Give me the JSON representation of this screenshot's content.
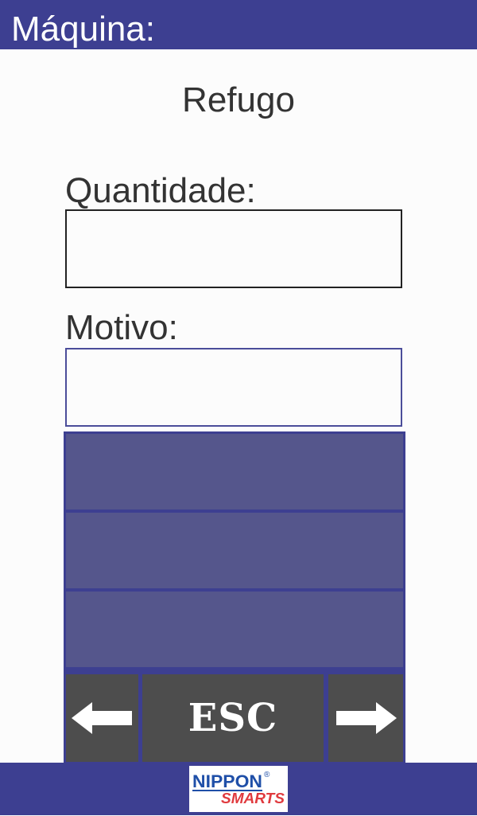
{
  "header": {
    "title": "Máquina:"
  },
  "page": {
    "title": "Refugo"
  },
  "form": {
    "quantity_label": "Quantidade:",
    "quantity_value": "",
    "reason_label": "Motivo:",
    "reason_value": ""
  },
  "reason_list": {
    "items": [
      "",
      "",
      ""
    ]
  },
  "nav": {
    "prev_icon": "arrow-left-icon",
    "esc_label": "ESC",
    "next_icon": "arrow-right-icon"
  },
  "footer": {
    "logo_line1": "NIPPON",
    "logo_line2": "SMARTS",
    "logo_mark": "®"
  },
  "colors": {
    "primary": "#3d3f91",
    "list_row": "#55568c",
    "nav_button": "#4d4d4d",
    "logo_blue": "#1f4fa8",
    "logo_red": "#e03a3e"
  }
}
